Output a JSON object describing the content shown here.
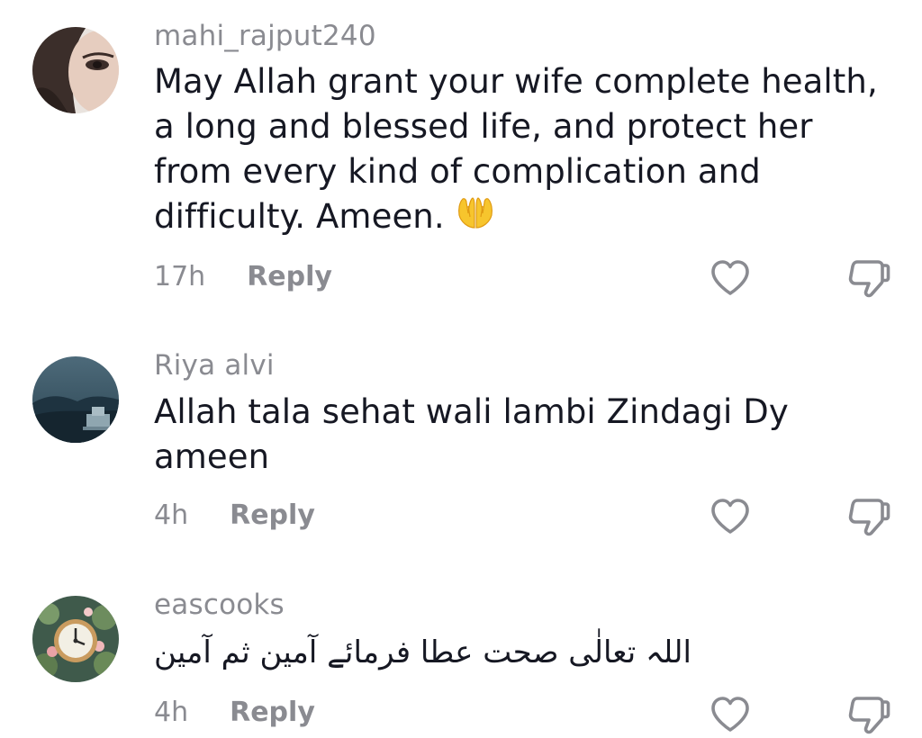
{
  "comments": [
    {
      "username": "mahi_rajput240",
      "lines": [
        "May Allah grant your wife complete health,",
        "a long and blessed life, and protect her",
        "from every kind of complication and",
        "difficulty. Ameen."
      ],
      "emoji": "praying-hands-emoji",
      "time": "17h",
      "reply_label": "Reply"
    },
    {
      "username": "Riya alvi",
      "lines": [
        "Allah tala sehat wali lambi Zindagi Dy",
        "ameen"
      ],
      "time": "4h",
      "reply_label": "Reply"
    },
    {
      "username": "eascooks",
      "lines": [
        "اللہ تعالٰی صحت عطا فرمائے آمین ثم آمین"
      ],
      "time": "4h",
      "reply_label": "Reply"
    }
  ],
  "icons": {
    "like": "heart-outline-icon",
    "dislike": "thumbs-down-outline-icon"
  },
  "colors": {
    "text": "#161823",
    "secondary": "#8a8b91",
    "icon": "#8a8b91",
    "emoji": "#f7c52d"
  }
}
